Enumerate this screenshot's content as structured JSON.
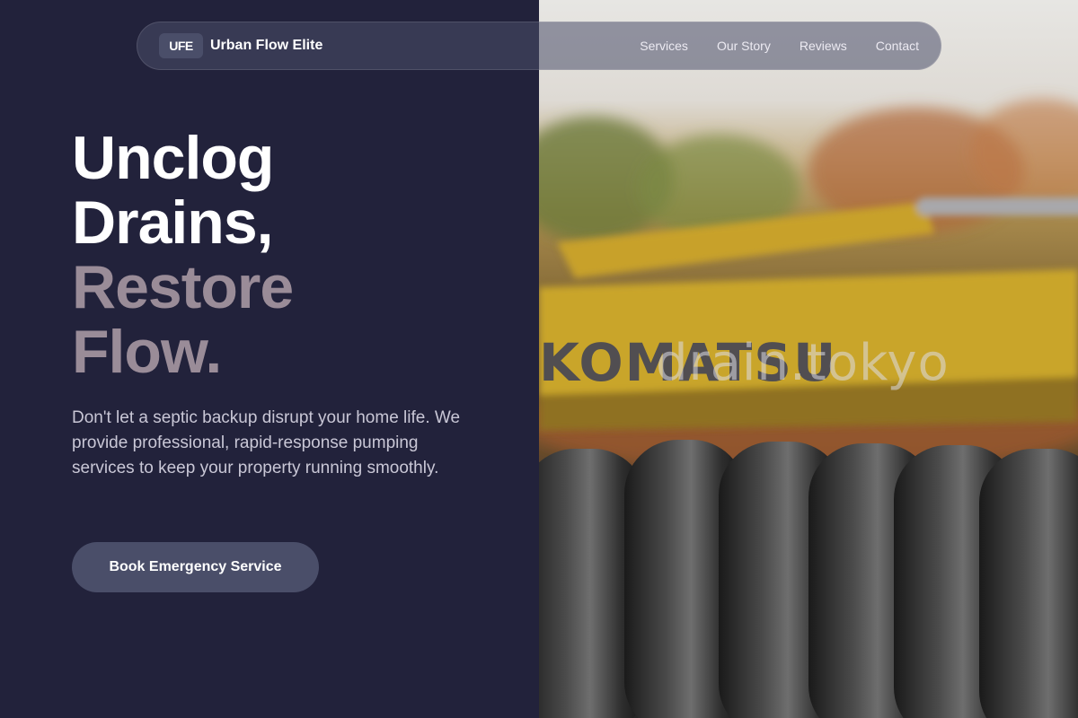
{
  "nav": {
    "logo_badge": "UFE",
    "brand_name": "Urban Flow Elite",
    "links": [
      "Services",
      "Our Story",
      "Reviews",
      "Contact"
    ]
  },
  "hero": {
    "title_line1": "Unclog",
    "title_line2": "Drains,",
    "title_line3": "Restore",
    "title_line4": "Flow.",
    "subtitle": "Don't let a septic backup disrupt your home life. We provide professional, rapid-response pumping services to keep your property running smoothly.",
    "cta_label": "Book Emergency Service"
  },
  "photo": {
    "watermark": "drain.tokyo",
    "machine_brand": "KOMATSU"
  },
  "colors": {
    "background": "#22223b",
    "accent": "#4a4e69",
    "muted_heading": "#9a8c98",
    "text_light": "#c9c7d6"
  },
  "icons": [
    "logo-badge-icon"
  ]
}
